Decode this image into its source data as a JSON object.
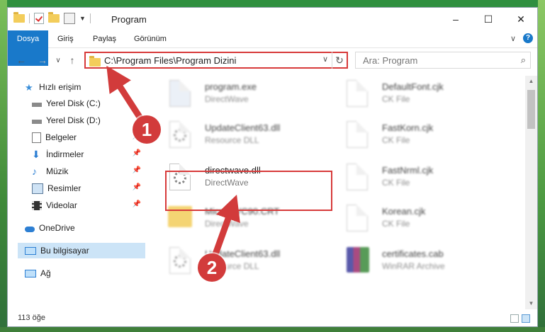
{
  "window": {
    "title": "Program",
    "controls": {
      "minimize": "–",
      "maximize": "☐",
      "close": "✕"
    }
  },
  "ribbon": {
    "tabs": [
      "Dosya",
      "Giriş",
      "Paylaş",
      "Görünüm"
    ],
    "expand_icon": "chevron-down-icon",
    "help_label": "?"
  },
  "nav": {
    "back": "←",
    "forward": "→",
    "dropdown": "∨",
    "up": "↑"
  },
  "address": {
    "path": "C:\\Program Files\\Program Dizini",
    "dropdown": "∨",
    "refresh": "↻"
  },
  "search": {
    "placeholder": "Ara: Program",
    "icon": "⌕"
  },
  "sidebar": {
    "items": [
      {
        "label": "Hızlı erişim",
        "icon": "star-icon"
      },
      {
        "label": "Yerel Disk (C:)",
        "icon": "drive-icon"
      },
      {
        "label": "Yerel Disk (D:)",
        "icon": "drive-icon"
      },
      {
        "label": "Belgeler",
        "icon": "documents-icon"
      },
      {
        "label": "İndirmeler",
        "icon": "downloads-icon"
      },
      {
        "label": "Müzik",
        "icon": "music-icon"
      },
      {
        "label": "Resimler",
        "icon": "pictures-icon"
      },
      {
        "label": "Videolar",
        "icon": "videos-icon"
      },
      {
        "label": "OneDrive",
        "icon": "cloud-icon"
      },
      {
        "label": "Bu bilgisayar",
        "icon": "computer-icon"
      },
      {
        "label": "Ağ",
        "icon": "network-icon"
      }
    ]
  },
  "files": [
    {
      "name": "program.exe",
      "desc": "DirectWave"
    },
    {
      "name": "DefaultFont.cjk",
      "desc": "CK File"
    },
    {
      "name": "UpdateClient63.dll",
      "desc": "Resource DLL"
    },
    {
      "name": "FastKorn.cjk",
      "desc": "CK File"
    },
    {
      "name": "directwave.dll",
      "desc": "DirectWave"
    },
    {
      "name": "FastNrml.cjk",
      "desc": "CK File"
    },
    {
      "name": "Micro...VC90.CRT",
      "desc": "DirectWave"
    },
    {
      "name": "Korean.cjk",
      "desc": "CK File"
    },
    {
      "name": "UpdateClient63.dll",
      "desc": "Resource DLL"
    },
    {
      "name": "certificates.cab",
      "desc": "WinRAR Archive"
    }
  ],
  "status": {
    "count": "113 öğe"
  },
  "annotations": {
    "step1": "1",
    "step2": "2"
  },
  "colors": {
    "accent": "#1979ca",
    "highlight": "#d73a3a",
    "selection": "#cce4f7"
  }
}
